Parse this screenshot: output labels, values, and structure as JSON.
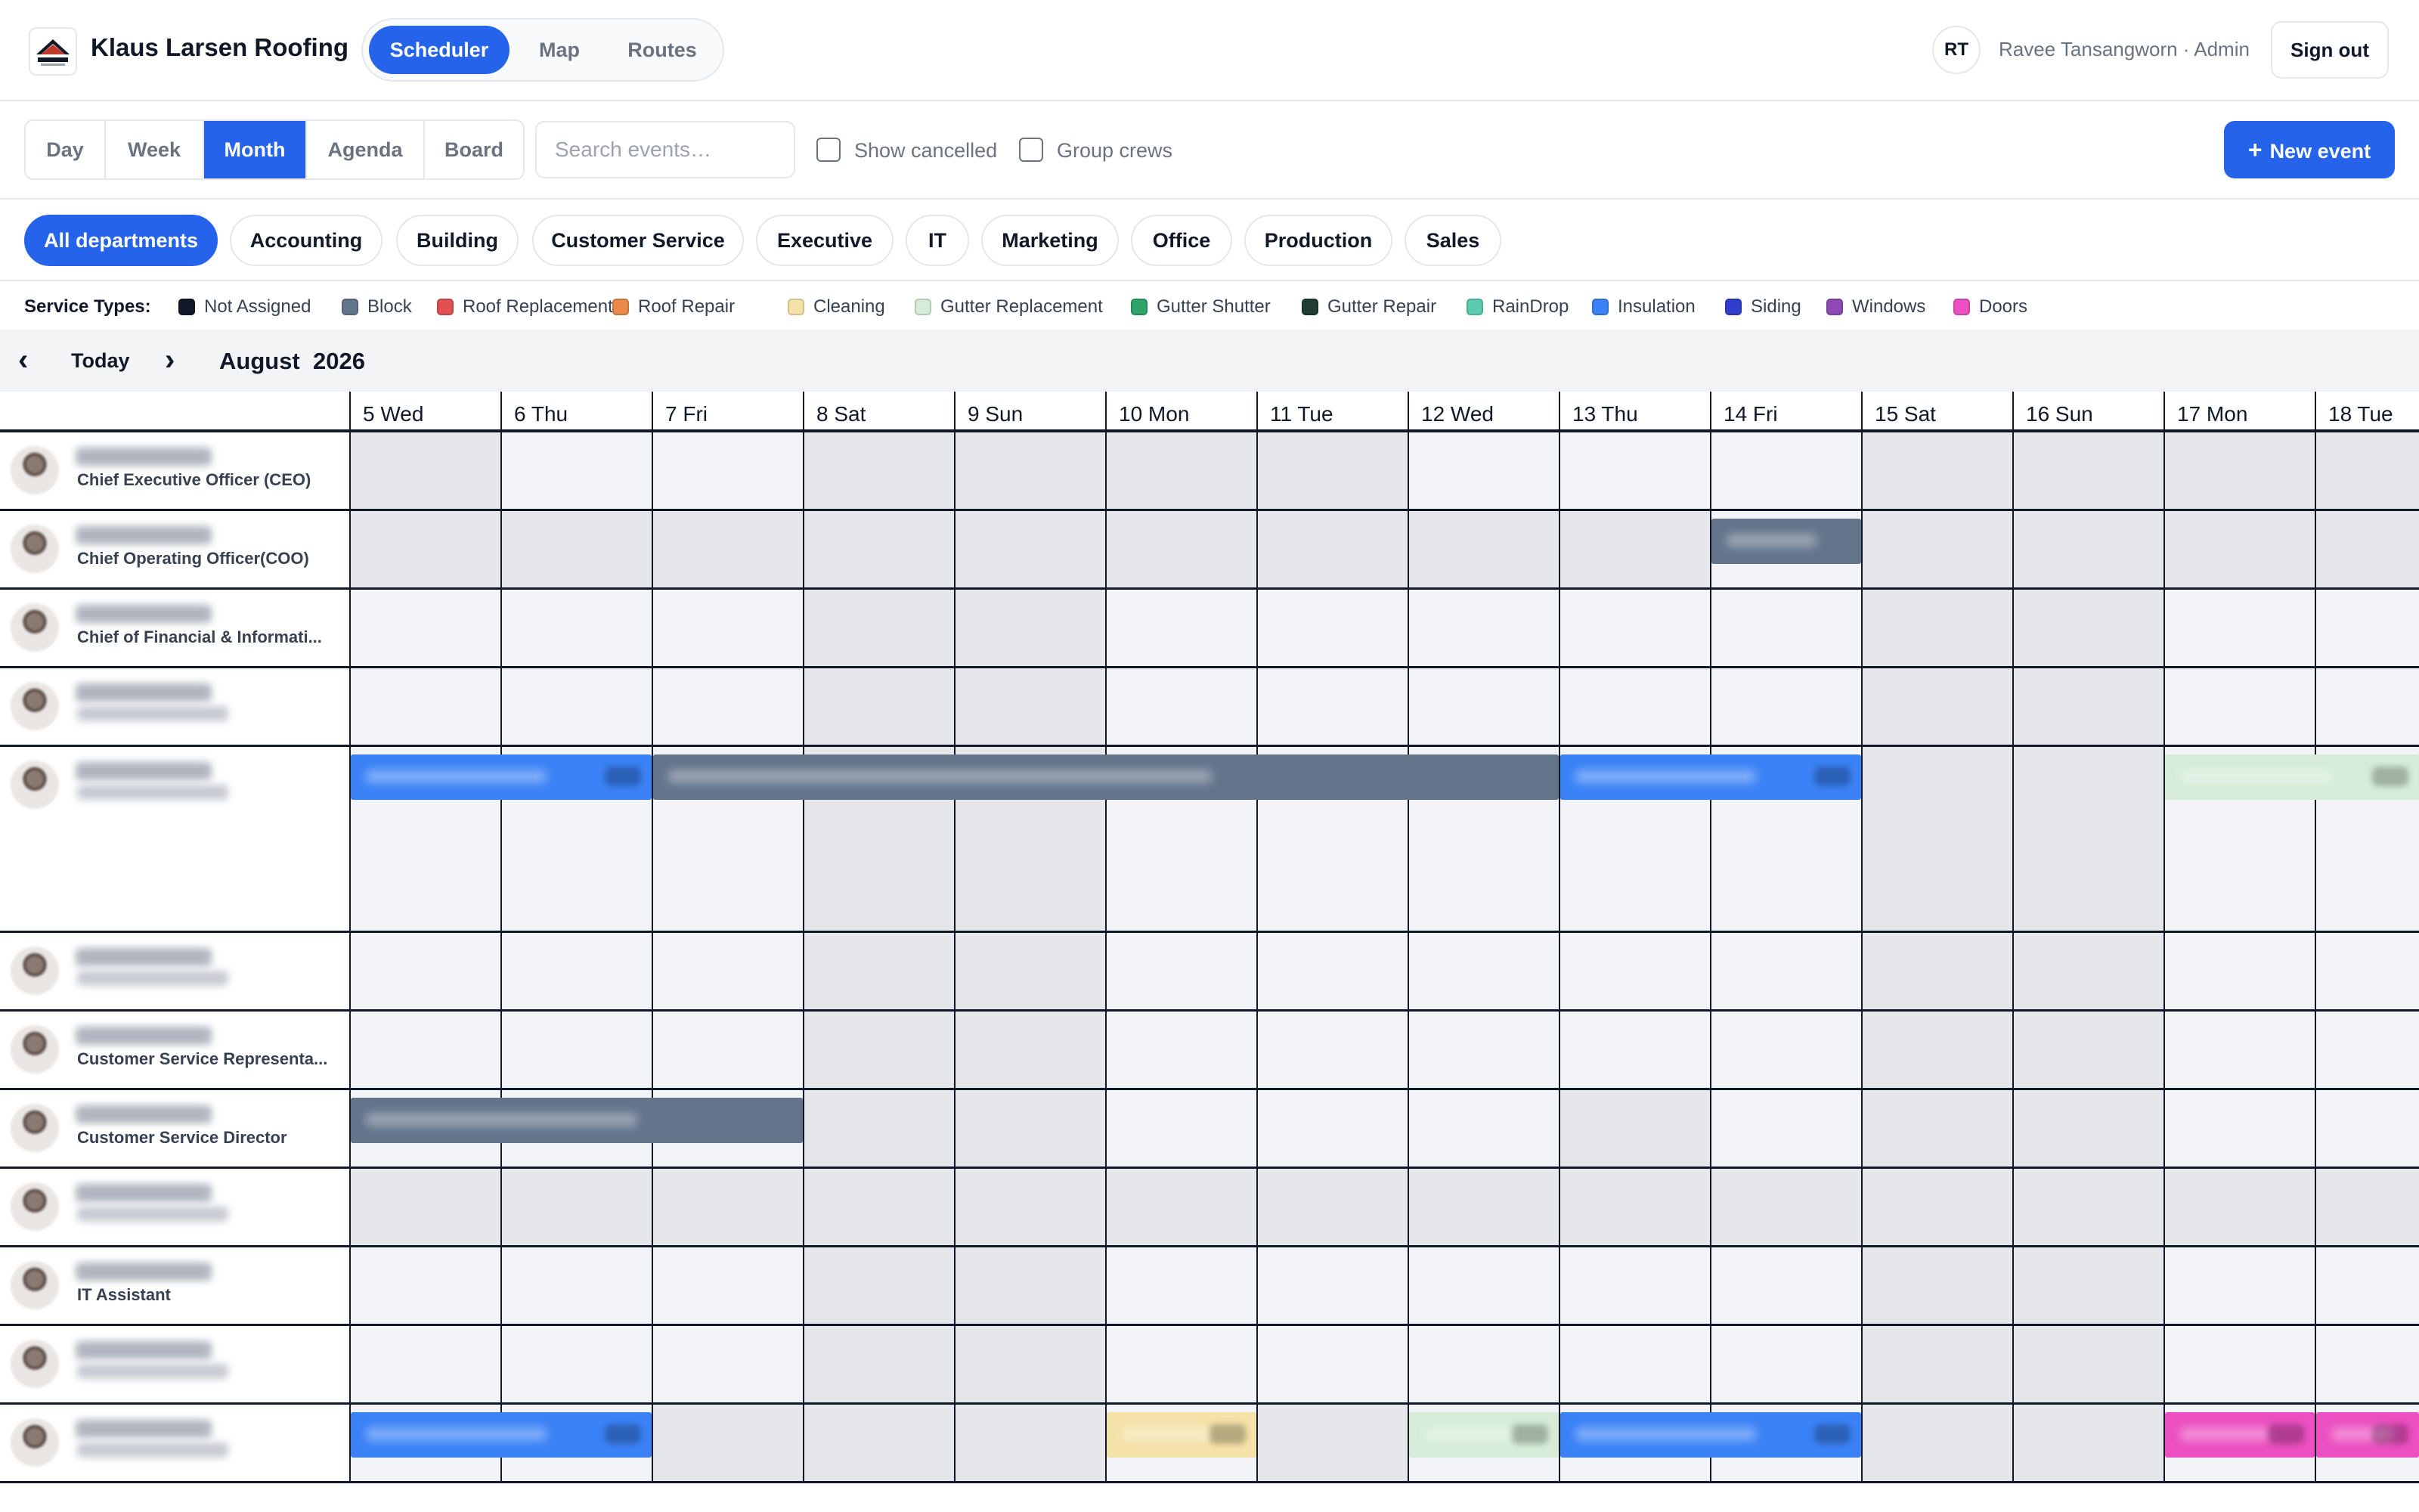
{
  "app": {
    "brand": "Klaus Larsen Roofing",
    "nav": [
      "Scheduler",
      "Map",
      "Routes"
    ],
    "nav_active": "Scheduler",
    "user_initials": "RT",
    "user_label": "Ravee Tansangworn · Admin",
    "signout": "Sign out"
  },
  "toolbar": {
    "views": [
      "Day",
      "Week",
      "Month",
      "Agenda",
      "Board"
    ],
    "view_active": "Month",
    "search_placeholder": "Search events…",
    "show_cancelled": "Show cancelled",
    "group_crews": "Group crews",
    "new_event": "New event"
  },
  "departments": [
    "All departments",
    "Accounting",
    "Building",
    "Customer Service",
    "Executive",
    "IT",
    "Marketing",
    "Office",
    "Production",
    "Sales"
  ],
  "department_active": "All departments",
  "legend": {
    "title": "Service Types:",
    "items": [
      {
        "label": "Not Assigned",
        "color": "#111827"
      },
      {
        "label": "Block",
        "color": "#64748b"
      },
      {
        "label": "Roof Replacement",
        "color": "#e05252"
      },
      {
        "label": "Roof Repair",
        "color": "#ea8a4a"
      },
      {
        "label": "Cleaning",
        "color": "#f5e2a8"
      },
      {
        "label": "Gutter Replacement",
        "color": "#d6ecd8"
      },
      {
        "label": "Gutter Shutter",
        "color": "#2ea36a"
      },
      {
        "label": "Gutter Repair",
        "color": "#1f3d32"
      },
      {
        "label": "RainDrop",
        "color": "#5ccbb0"
      },
      {
        "label": "Insulation",
        "color": "#3b82f6"
      },
      {
        "label": "Siding",
        "color": "#2f3fc9"
      },
      {
        "label": "Windows",
        "color": "#8e4bb5"
      },
      {
        "label": "Doors",
        "color": "#ec4fc1"
      }
    ]
  },
  "calendar": {
    "today": "Today",
    "month_label": "August  2026",
    "days": [
      {
        "label": "5 Wed",
        "weekend": false
      },
      {
        "label": "6 Thu",
        "weekend": false
      },
      {
        "label": "7 Fri",
        "weekend": false
      },
      {
        "label": "8 Sat",
        "weekend": true
      },
      {
        "label": "9 Sun",
        "weekend": true
      },
      {
        "label": "10 Mon",
        "weekend": false
      },
      {
        "label": "11 Tue",
        "weekend": false
      },
      {
        "label": "12 Wed",
        "weekend": false
      },
      {
        "label": "13 Thu",
        "weekend": false
      },
      {
        "label": "14 Fri",
        "weekend": false
      },
      {
        "label": "15 Sat",
        "weekend": true
      },
      {
        "label": "16 Sun",
        "weekend": true
      },
      {
        "label": "17 Mon",
        "weekend": false
      },
      {
        "label": "18 Tue",
        "weekend": false
      }
    ],
    "rows": [
      {
        "title": "Chief Executive Officer (CEO)",
        "title_visible": true,
        "tall": false,
        "off_days": [
          0,
          3,
          4,
          5,
          6,
          10,
          11,
          12,
          13
        ],
        "events": []
      },
      {
        "title": "Chief Operating Officer(COO)",
        "title_visible": true,
        "tall": false,
        "off_days": [
          0,
          1,
          2,
          3,
          4,
          5,
          6,
          7,
          8,
          10,
          11,
          12,
          13
        ],
        "events": [
          {
            "type": "Block",
            "start": 9,
            "span": 1
          }
        ]
      },
      {
        "title": "Chief of Financial & Informati...",
        "title_visible": true,
        "tall": false,
        "off_days": [
          3,
          4,
          10,
          11
        ],
        "events": []
      },
      {
        "title": "",
        "title_visible": false,
        "tall": false,
        "off_days": [
          3,
          4,
          10,
          11
        ],
        "events": []
      },
      {
        "title": "",
        "title_visible": false,
        "tall": true,
        "off_days": [
          3,
          4,
          10,
          11
        ],
        "events": [
          {
            "type": "Insulation",
            "start": 0,
            "span": 2
          },
          {
            "type": "Block",
            "start": 2,
            "span": 6
          },
          {
            "type": "Insulation",
            "start": 8,
            "span": 2
          },
          {
            "type": "Gutter Replacement",
            "start": 12,
            "span": 2
          }
        ]
      },
      {
        "title": "",
        "title_visible": false,
        "tall": false,
        "off_days": [
          3,
          4,
          10,
          11
        ],
        "events": []
      },
      {
        "title": "Customer Service Representa...",
        "title_visible": true,
        "tall": false,
        "off_days": [
          3,
          4,
          10,
          11
        ],
        "events": []
      },
      {
        "title": "Customer Service Director",
        "title_visible": true,
        "tall": false,
        "off_days": [
          3,
          4,
          8,
          10,
          11
        ],
        "events": [
          {
            "type": "Block",
            "start": 0,
            "span": 3
          }
        ]
      },
      {
        "title": "",
        "title_visible": false,
        "tall": false,
        "off_days": [
          0,
          1,
          2,
          3,
          4,
          5,
          6,
          7,
          8,
          9,
          10,
          11,
          12,
          13
        ],
        "events": []
      },
      {
        "title": "IT Assistant",
        "title_visible": true,
        "tall": false,
        "off_days": [
          3,
          4,
          10,
          11
        ],
        "events": []
      },
      {
        "title": "",
        "title_visible": false,
        "tall": false,
        "off_days": [
          3,
          4,
          10,
          11
        ],
        "events": []
      },
      {
        "title": "",
        "title_visible": false,
        "tall": false,
        "off_days": [
          2,
          3,
          4,
          6,
          10,
          11
        ],
        "events": [
          {
            "type": "Insulation",
            "start": 0,
            "span": 2
          },
          {
            "type": "Cleaning",
            "start": 5,
            "span": 1
          },
          {
            "type": "Gutter Replacement",
            "start": 7,
            "span": 1
          },
          {
            "type": "Insulation",
            "start": 8,
            "span": 2
          },
          {
            "type": "Doors",
            "start": 12,
            "span": 1
          },
          {
            "type": "Doors",
            "start": 13,
            "span": 1
          }
        ]
      }
    ]
  }
}
